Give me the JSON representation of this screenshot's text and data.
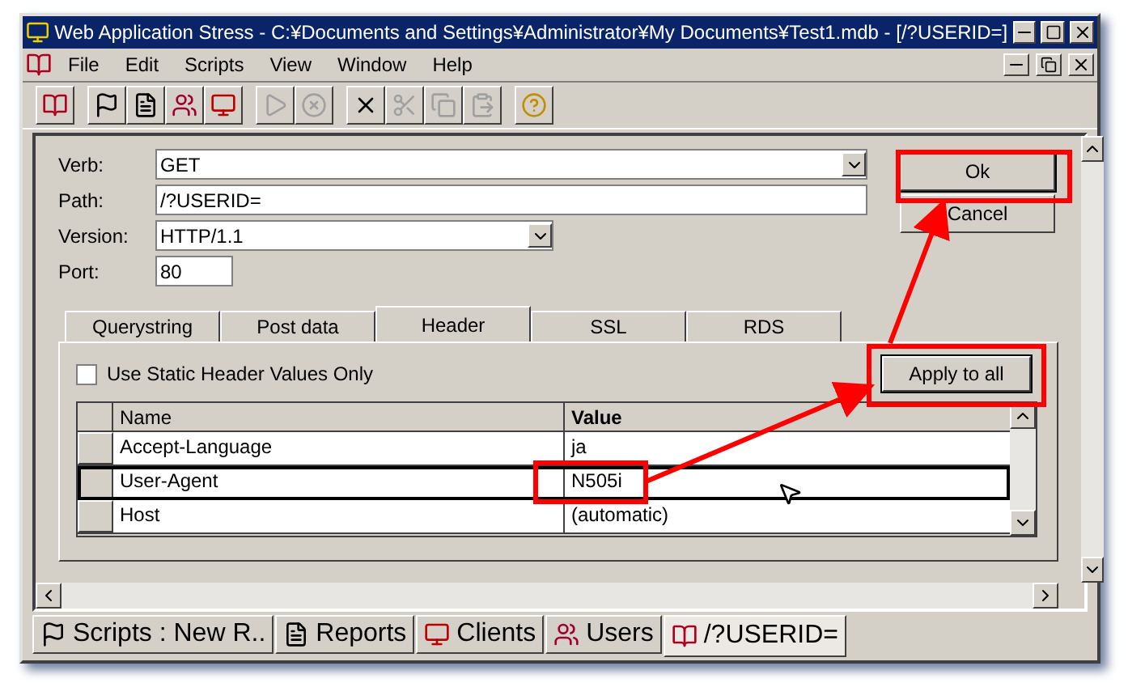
{
  "window": {
    "title": "Web Application Stress - C:¥Documents and Settings¥Administrator¥My Documents¥Test1.mdb - [/?USERID=]"
  },
  "menu": [
    "File",
    "Edit",
    "Scripts",
    "View",
    "Window",
    "Help"
  ],
  "toolbar": [
    {
      "kind": "open",
      "disabled": false
    },
    {
      "kind": "flag",
      "disabled": false
    },
    {
      "kind": "report",
      "disabled": false
    },
    {
      "kind": "users",
      "disabled": false
    },
    {
      "kind": "clients",
      "disabled": false
    },
    {
      "kind": "run",
      "disabled": true
    },
    {
      "kind": "stop",
      "disabled": true
    },
    {
      "kind": "delete",
      "disabled": false
    },
    {
      "kind": "cut",
      "disabled": true
    },
    {
      "kind": "copy",
      "disabled": true
    },
    {
      "kind": "paste",
      "disabled": true
    },
    {
      "kind": "help",
      "disabled": false
    }
  ],
  "form": {
    "verb": {
      "label": "Verb:",
      "value": "GET"
    },
    "path": {
      "label": "Path:",
      "value": "/?USERID="
    },
    "version": {
      "label": "Version:",
      "value": "HTTP/1.1"
    },
    "port": {
      "label": "Port:",
      "value": "80"
    }
  },
  "buttons": [
    "Ok",
    "Cancel"
  ],
  "tabs": [
    {
      "label": "Querystring",
      "selected": false
    },
    {
      "label": "Post data",
      "selected": false
    },
    {
      "label": "Header",
      "selected": true
    },
    {
      "label": "SSL",
      "selected": false
    },
    {
      "label": "RDS",
      "selected": false
    }
  ],
  "static_checkbox": {
    "label": "Use Static Header Values Only",
    "checked": false
  },
  "apply_button": "Apply to all",
  "table": {
    "columns": [
      "Name",
      "Value"
    ],
    "rows": [
      {
        "name": "Accept-Language",
        "value": "ja",
        "selected": false
      },
      {
        "name": "User-Agent",
        "value": "N505i",
        "selected": true
      },
      {
        "name": "Host",
        "value": "(automatic)",
        "selected": false
      }
    ]
  },
  "bottom_tabs": [
    {
      "label": "Scripts : New R..",
      "kind": "flag",
      "selected": false
    },
    {
      "label": "Reports",
      "kind": "report",
      "selected": false
    },
    {
      "label": "Clients",
      "kind": "clients",
      "selected": false
    },
    {
      "label": "Users",
      "kind": "users",
      "selected": false
    },
    {
      "label": "/?USERID=",
      "kind": "open",
      "selected": true
    }
  ]
}
